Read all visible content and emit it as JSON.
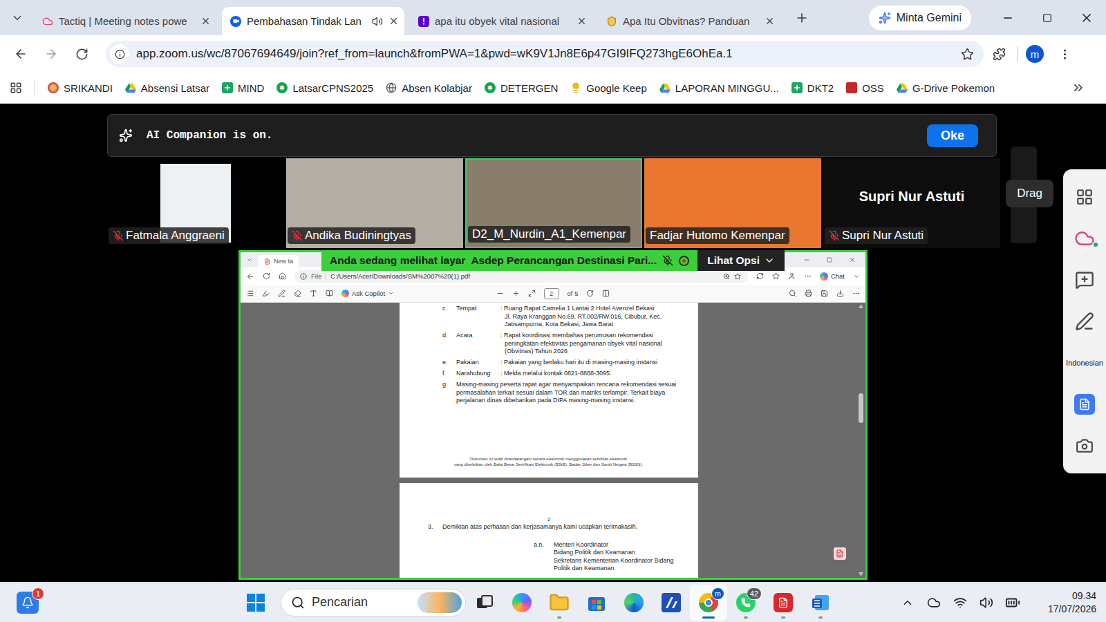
{
  "browser": {
    "tabs": [
      {
        "label": "Tactiq | Meeting notes powe",
        "selected": false,
        "audio": false,
        "kind": "tactiq"
      },
      {
        "label": "Pembahasan Tindak Lan",
        "selected": true,
        "audio": true,
        "kind": "zoom"
      },
      {
        "label": "apa itu obyek vital nasional",
        "selected": false,
        "audio": false,
        "kind": "yahoo"
      },
      {
        "label": "Apa Itu Obvitnas? Panduan",
        "selected": false,
        "audio": false,
        "kind": "shield"
      }
    ],
    "gemini": "Minta Gemini",
    "url": "app.zoom.us/wc/87067694649/join?ref_from=launch&fromPWA=1&pwd=wK9V1Jn8E6p47GI9IFQ273hgE6OhEa.1",
    "profile": "m",
    "bookmarks": [
      {
        "label": "SRIKANDI",
        "kind": "logo"
      },
      {
        "label": "Absensi Latsar",
        "kind": "drive"
      },
      {
        "label": "MIND",
        "kind": "sheet"
      },
      {
        "label": "LatsarCPNS2025",
        "kind": "star"
      },
      {
        "label": "Absen Kolabjar",
        "kind": "globe"
      },
      {
        "label": "DETERGEN",
        "kind": "star"
      },
      {
        "label": "Google Keep",
        "kind": "bulb"
      },
      {
        "label": "LAPORAN MINGGU...",
        "kind": "drive"
      },
      {
        "label": "DKT2",
        "kind": "sheet"
      },
      {
        "label": "OSS",
        "kind": "oss"
      },
      {
        "label": "G-Drive Pokemon",
        "kind": "drive"
      }
    ]
  },
  "zoom": {
    "ai_banner": {
      "text": "AI Companion is on.",
      "button": "Oke"
    },
    "participants": [
      {
        "name": "Fatmala Anggraeni",
        "muted": true,
        "speaking": false,
        "kind": "avatar",
        "color": "#eef1f3"
      },
      {
        "name": "Andika Budiningtyas",
        "muted": true,
        "speaking": false,
        "kind": "video",
        "color": "#b5aea4"
      },
      {
        "name": "D2_M_Nurdin_A1_Kemenpar",
        "muted": false,
        "speaking": true,
        "kind": "video",
        "color": "#8a7d6c"
      },
      {
        "name": "Fadjar Hutomo Kemenpar",
        "muted": false,
        "speaking": false,
        "kind": "video",
        "color": "#e9772f"
      },
      {
        "name": "Supri Nur Astuti",
        "muted": true,
        "speaking": false,
        "kind": "name",
        "color": "#0d0d0d"
      }
    ],
    "tooltip": "Drag",
    "language": "Indonesian",
    "share": {
      "banner": "Anda sedang melihat layar",
      "presenter": "Asdep Perancangan Destinasi Pari...",
      "options": "Lihat Opsi",
      "muted": true,
      "recording": true
    }
  },
  "viewer": {
    "tab": "New ta",
    "scheme": "File",
    "path": "C:/Users/Acer/Downloads/SM%2007%20(1).pdf",
    "chat": "Chat",
    "copilot": "Ask Copilot",
    "page": "2",
    "page_count": "of 5",
    "scroll": 0.36,
    "page1": {
      "rows": [
        {
          "letter": "c.",
          "label": "Tempat",
          "kind": "field",
          "lines": [
            ": Ruang Rapat Camelia 1 Lantai 2 Hotel Avenzel Bekasi",
            "Jl. Raya Kranggan No.69, RT.002/RW.016, Cibubur, Kec.",
            "Jatisampurna, Kota Bekasi, Jawa Barat"
          ]
        },
        {
          "letter": "d.",
          "label": "Acara",
          "kind": "field",
          "lines": [
            ": Rapat koordinasi membahas perumusan rekomendasi",
            "peningkatan efektivitas pengamanan obyek vital nasional",
            "(Obvitnas) Tahun 2026"
          ]
        },
        {
          "letter": "e.",
          "label": "Pakaian",
          "kind": "field",
          "lines": [
            ": Pakaian yang berlaku hari itu di masing-masing instansi"
          ]
        },
        {
          "letter": "f.",
          "label": "Narahubung",
          "kind": "field",
          "lines": [
            ": Melda melalui kontak 0821-8888-3095."
          ]
        },
        {
          "letter": "g.",
          "kind": "paragraph",
          "lines": [
            "Masing-masing peserta rapat agar menyampaikan rencana rekomendasi sesuai",
            "permasalahan terkait sesuai dalam TOR dan matriks terlampir. Terkait biaya",
            "perjalanan dinas dibebankan pada DIPA masing-masing instansi."
          ]
        }
      ],
      "footer": [
        "Dokumen ini telah ditandatangani secara elektronik menggunakan sertifikat elektronik",
        "yang diterbitkan oleh Balai Besar Sertifikasi Elektronik (BSrE), Badan Siber dan Sandi Negara (BSSN)."
      ]
    },
    "page2": {
      "number": "2",
      "items": [
        {
          "num": "3.",
          "text": "Demikian atas perhatian dan kerjasamanya kami ucapkan terimakasih."
        }
      ],
      "signature": {
        "prefix": "a.n.",
        "lines": [
          "Menteri Koordinator",
          "Bidang Politik dan Keamanan",
          "Sekretaris Kementerian Koordinator Bidang",
          "Politik dan Keamanan"
        ]
      }
    }
  },
  "taskbar": {
    "notifications": "1",
    "search": "Pencarian",
    "apps": [
      {
        "kind": "taskview",
        "running": false,
        "selected": false,
        "badge": ""
      },
      {
        "kind": "copilot",
        "running": false,
        "selected": false,
        "badge": ""
      },
      {
        "kind": "explorer",
        "running": true,
        "selected": false,
        "badge": ""
      },
      {
        "kind": "store",
        "running": false,
        "selected": false,
        "badge": ""
      },
      {
        "kind": "edge",
        "running": false,
        "selected": false,
        "badge": ""
      },
      {
        "kind": "app",
        "running": false,
        "selected": false,
        "badge": ""
      },
      {
        "kind": "chrome",
        "running": true,
        "selected": true,
        "badge": "m"
      },
      {
        "kind": "whatsapp",
        "running": true,
        "selected": false,
        "badge": "42"
      },
      {
        "kind": "acrobat",
        "running": true,
        "selected": false,
        "badge": ""
      },
      {
        "kind": "word",
        "running": true,
        "selected": false,
        "badge": ""
      }
    ],
    "time": "09.34",
    "date": "17/07/2026"
  }
}
